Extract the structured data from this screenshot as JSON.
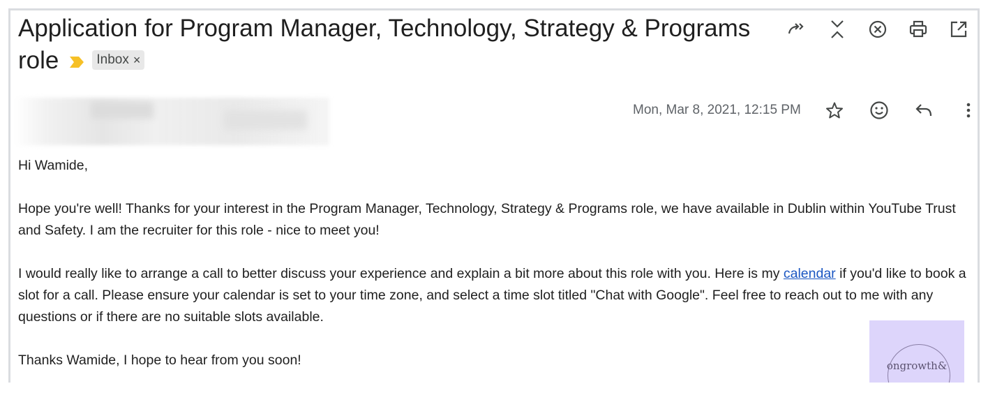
{
  "subject": {
    "title": "Application for Program Manager, Technology, Strategy & Programs role",
    "label_chip": "Inbox",
    "label_chip_close": "×",
    "marker_color": "#f6c026"
  },
  "toolbar": {
    "icons": [
      "forward-all-icon",
      "collapse-icon",
      "close-circle-icon",
      "print-icon",
      "open-in-new-window-icon"
    ]
  },
  "message": {
    "date": "Mon, Mar 8, 2021, 12:15 PM",
    "icons": [
      "star-icon",
      "emoji-icon",
      "reply-icon",
      "more-options-icon"
    ],
    "greeting": "Hi Wamide,",
    "para1": "Hope you're well!  Thanks for your interest in the Program Manager, Technology, Strategy & Programs role, we have available in Dublin within YouTube Trust and Safety. I am the recruiter for this role - nice to meet you!",
    "para2_before": "I would really like to arrange a call to better discuss your experience and explain a bit more about this role with you. Here is my ",
    "para2_link": "calendar",
    "para2_after": " if you'd like to book a slot for a call. Please ensure your calendar is set to your time zone, and select a time slot titled \"Chat with Google\". Feel free to reach out to me with any questions or if there are no suitable slots available.",
    "closing": "Thanks Wamide, I hope to hear from you soon!"
  },
  "watermark": {
    "text": "ongrowth&",
    "bg_color": "#ddd5fb"
  },
  "colors": {
    "link": "#1a56c2",
    "icon": "#444746",
    "date_text": "#5f6368"
  }
}
